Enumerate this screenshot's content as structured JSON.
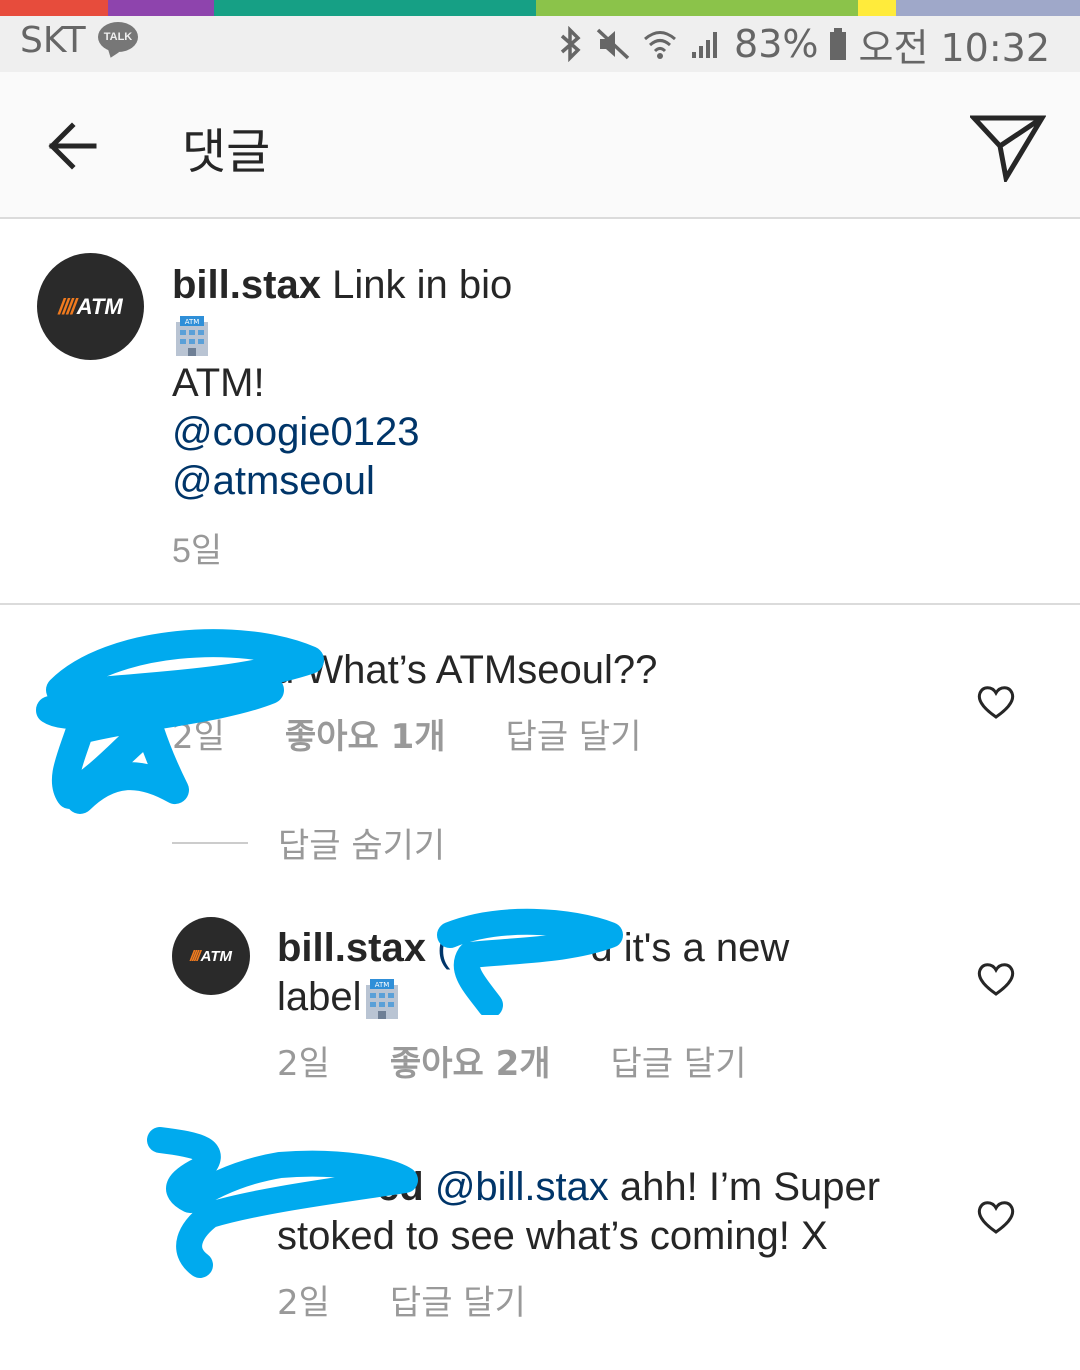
{
  "colors": {
    "strip": [
      "#e74c3c",
      "#8e44ad",
      "#16a085",
      "#8bc34a",
      "#ffeb3b",
      "#9fa8c9"
    ],
    "mention": "#003569",
    "meta": "#999999",
    "scribble": "#00aaee"
  },
  "status_bar": {
    "carrier": "SKT",
    "talk_badge": "TALK",
    "battery": "83%",
    "time": "오전 10:32",
    "icons": [
      "bluetooth-icon",
      "mute-icon",
      "wifi-icon",
      "signal-icon",
      "battery-icon"
    ]
  },
  "header": {
    "title": "댓글",
    "back_icon": "arrow-left-icon",
    "send_icon": "paper-plane-icon"
  },
  "caption": {
    "avatar_text": "ATM",
    "username": "bill.stax",
    "first_line": "Link in bio",
    "emoji": "atm-building-emoji",
    "line2": "ATM!",
    "mention1": "@coogie0123",
    "mention2": "@atmseoul",
    "time": "5일"
  },
  "comments": [
    {
      "text_visible": "d What’s ATMseoul??",
      "time": "2일",
      "likes": "좋아요 1개",
      "reply": "답글 달기"
    }
  ],
  "hide_replies": "답글 숨기기",
  "replies": [
    {
      "avatar_text": "ATM",
      "username": "bill.stax",
      "mention_visible": "(",
      "text_tail": "d it's a new",
      "line2": "label",
      "time": "2일",
      "likes": "좋아요 2개",
      "reply": "답글 달기"
    },
    {
      "username_visible": "ed",
      "mention": "@bill.stax",
      "text_line1": "ahh! I’m Super",
      "text_line2": "stoked to see what’s coming! X",
      "time": "2일",
      "reply": "답글 달기"
    }
  ]
}
